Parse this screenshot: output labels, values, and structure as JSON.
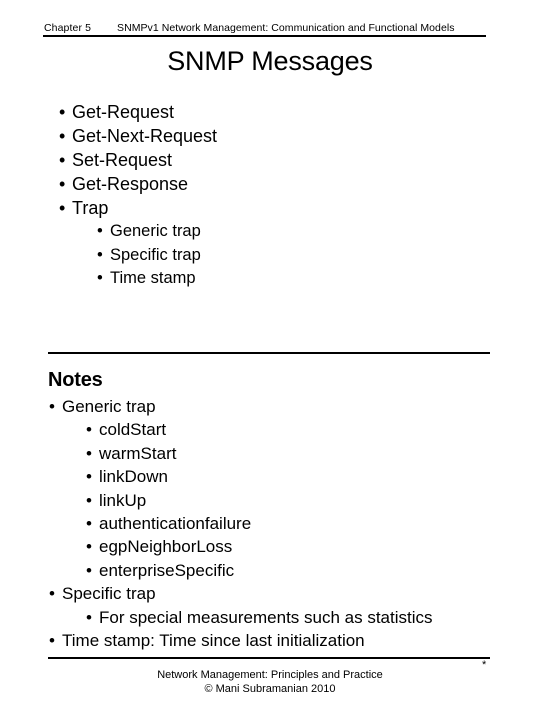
{
  "header": {
    "chapter": "Chapter 5",
    "subtitle": "SNMPv1 Network Management:  Communication and Functional Models"
  },
  "title": "SNMP Messages",
  "main_list": [
    {
      "level": 1,
      "text": "Get-Request"
    },
    {
      "level": 1,
      "text": "Get-Next-Request"
    },
    {
      "level": 1,
      "text": "Set-Request"
    },
    {
      "level": 1,
      "text": "Get-Response"
    },
    {
      "level": 1,
      "text": "Trap"
    },
    {
      "level": 2,
      "text": "Generic trap"
    },
    {
      "level": 2,
      "text": "Specific trap"
    },
    {
      "level": 2,
      "text": "Time stamp"
    }
  ],
  "notes": {
    "heading": "Notes",
    "items": [
      {
        "level": 1,
        "text": "Generic trap"
      },
      {
        "level": 2,
        "text": "coldStart"
      },
      {
        "level": 2,
        "text": "warmStart"
      },
      {
        "level": 2,
        "text": "linkDown"
      },
      {
        "level": 2,
        "text": "linkUp"
      },
      {
        "level": 2,
        "text": "authenticationfailure"
      },
      {
        "level": 2,
        "text": "egpNeighborLoss"
      },
      {
        "level": 2,
        "text": "enterpriseSpecific"
      },
      {
        "level": 1,
        "text": "Specific trap"
      },
      {
        "level": 2,
        "text": "For special measurements such as statistics"
      },
      {
        "level": 1,
        "text": "Time stamp: Time since last initialization"
      }
    ]
  },
  "footer": {
    "page_marker": "*",
    "line1": "Network Management: Principles and Practice",
    "line2": "©  Mani Subramanian 2010"
  },
  "bullet_glyph": "•",
  "colors": {
    "background": "#ffffff",
    "text": "#000000",
    "rule": "#000000"
  }
}
